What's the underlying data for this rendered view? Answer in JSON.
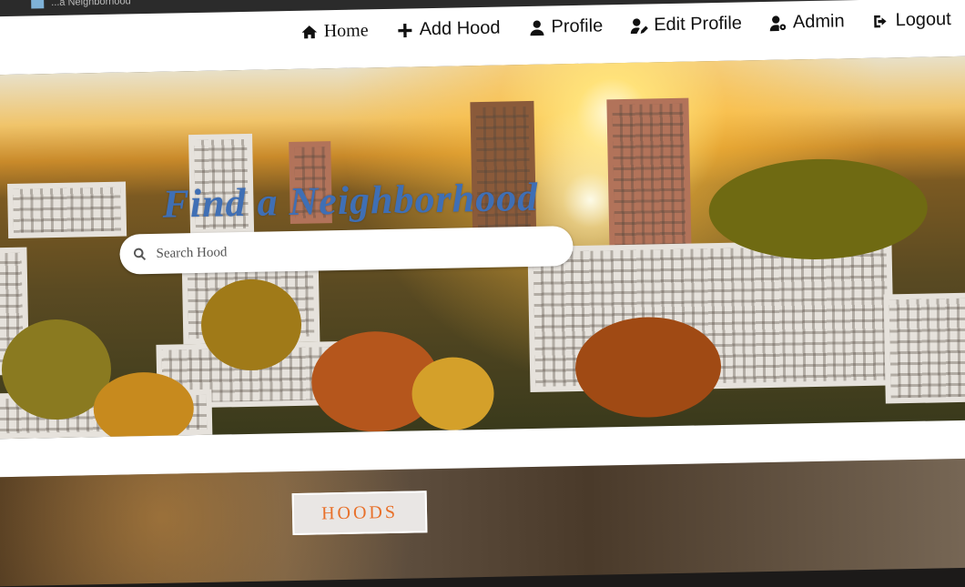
{
  "browser": {
    "tab_title": "...a Neighborhood"
  },
  "nav": {
    "items": [
      {
        "label": "Home",
        "icon": "home-icon"
      },
      {
        "label": "Add Hood",
        "icon": "plus-icon"
      },
      {
        "label": "Profile",
        "icon": "user-icon"
      },
      {
        "label": "Edit Profile",
        "icon": "user-edit-icon"
      },
      {
        "label": "Admin",
        "icon": "user-cog-icon"
      },
      {
        "label": "Logout",
        "icon": "sign-out-icon"
      }
    ]
  },
  "hero": {
    "title": "Find a Neighborhood",
    "search_placeholder": "Search Hood"
  },
  "section": {
    "hoods_label": "HOODS"
  },
  "colors": {
    "title": "#3f6fb5",
    "hoods_text": "#e8702a",
    "nav_bg": "#ffffff"
  }
}
